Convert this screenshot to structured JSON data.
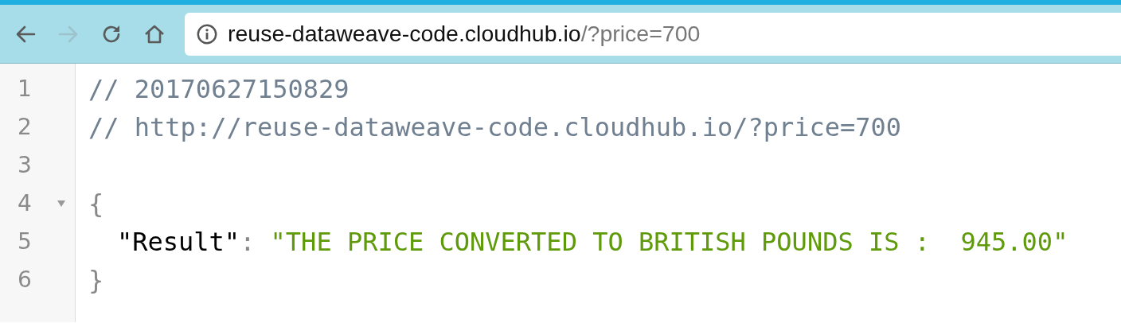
{
  "toolbar": {
    "buttons": [
      {
        "kind": "back",
        "disabled": false
      },
      {
        "kind": "forward",
        "disabled": true
      },
      {
        "kind": "reload",
        "disabled": false
      },
      {
        "kind": "home",
        "disabled": false
      }
    ]
  },
  "address": {
    "host": "reuse-dataweave-code.cloudhub.io",
    "path": "/?price=700"
  },
  "code": {
    "lines": [
      {
        "number": "1",
        "tokens": [
          {
            "kind": "comment",
            "text": "// 20170627150829"
          }
        ]
      },
      {
        "number": "2",
        "tokens": [
          {
            "kind": "comment",
            "text": "// http://reuse-dataweave-code.cloudhub.io/?price=700"
          }
        ]
      },
      {
        "number": "3"
      },
      {
        "number": "4",
        "tokens": [
          {
            "kind": "punct",
            "text": "{"
          }
        ],
        "expanded": true,
        "children": [
          {
            "number": "5",
            "tokens": [
              {
                "kind": "key",
                "text": "\"Result\""
              },
              {
                "kind": "punct",
                "text": ":"
              },
              {
                "kind": "string",
                "text": "\"THE PRICE CONVERTED TO BRITISH POUNDS IS :  945.00\""
              }
            ]
          }
        ]
      },
      {
        "number": "6",
        "tokens": [
          {
            "kind": "punct",
            "text": "}"
          }
        ]
      }
    ]
  }
}
